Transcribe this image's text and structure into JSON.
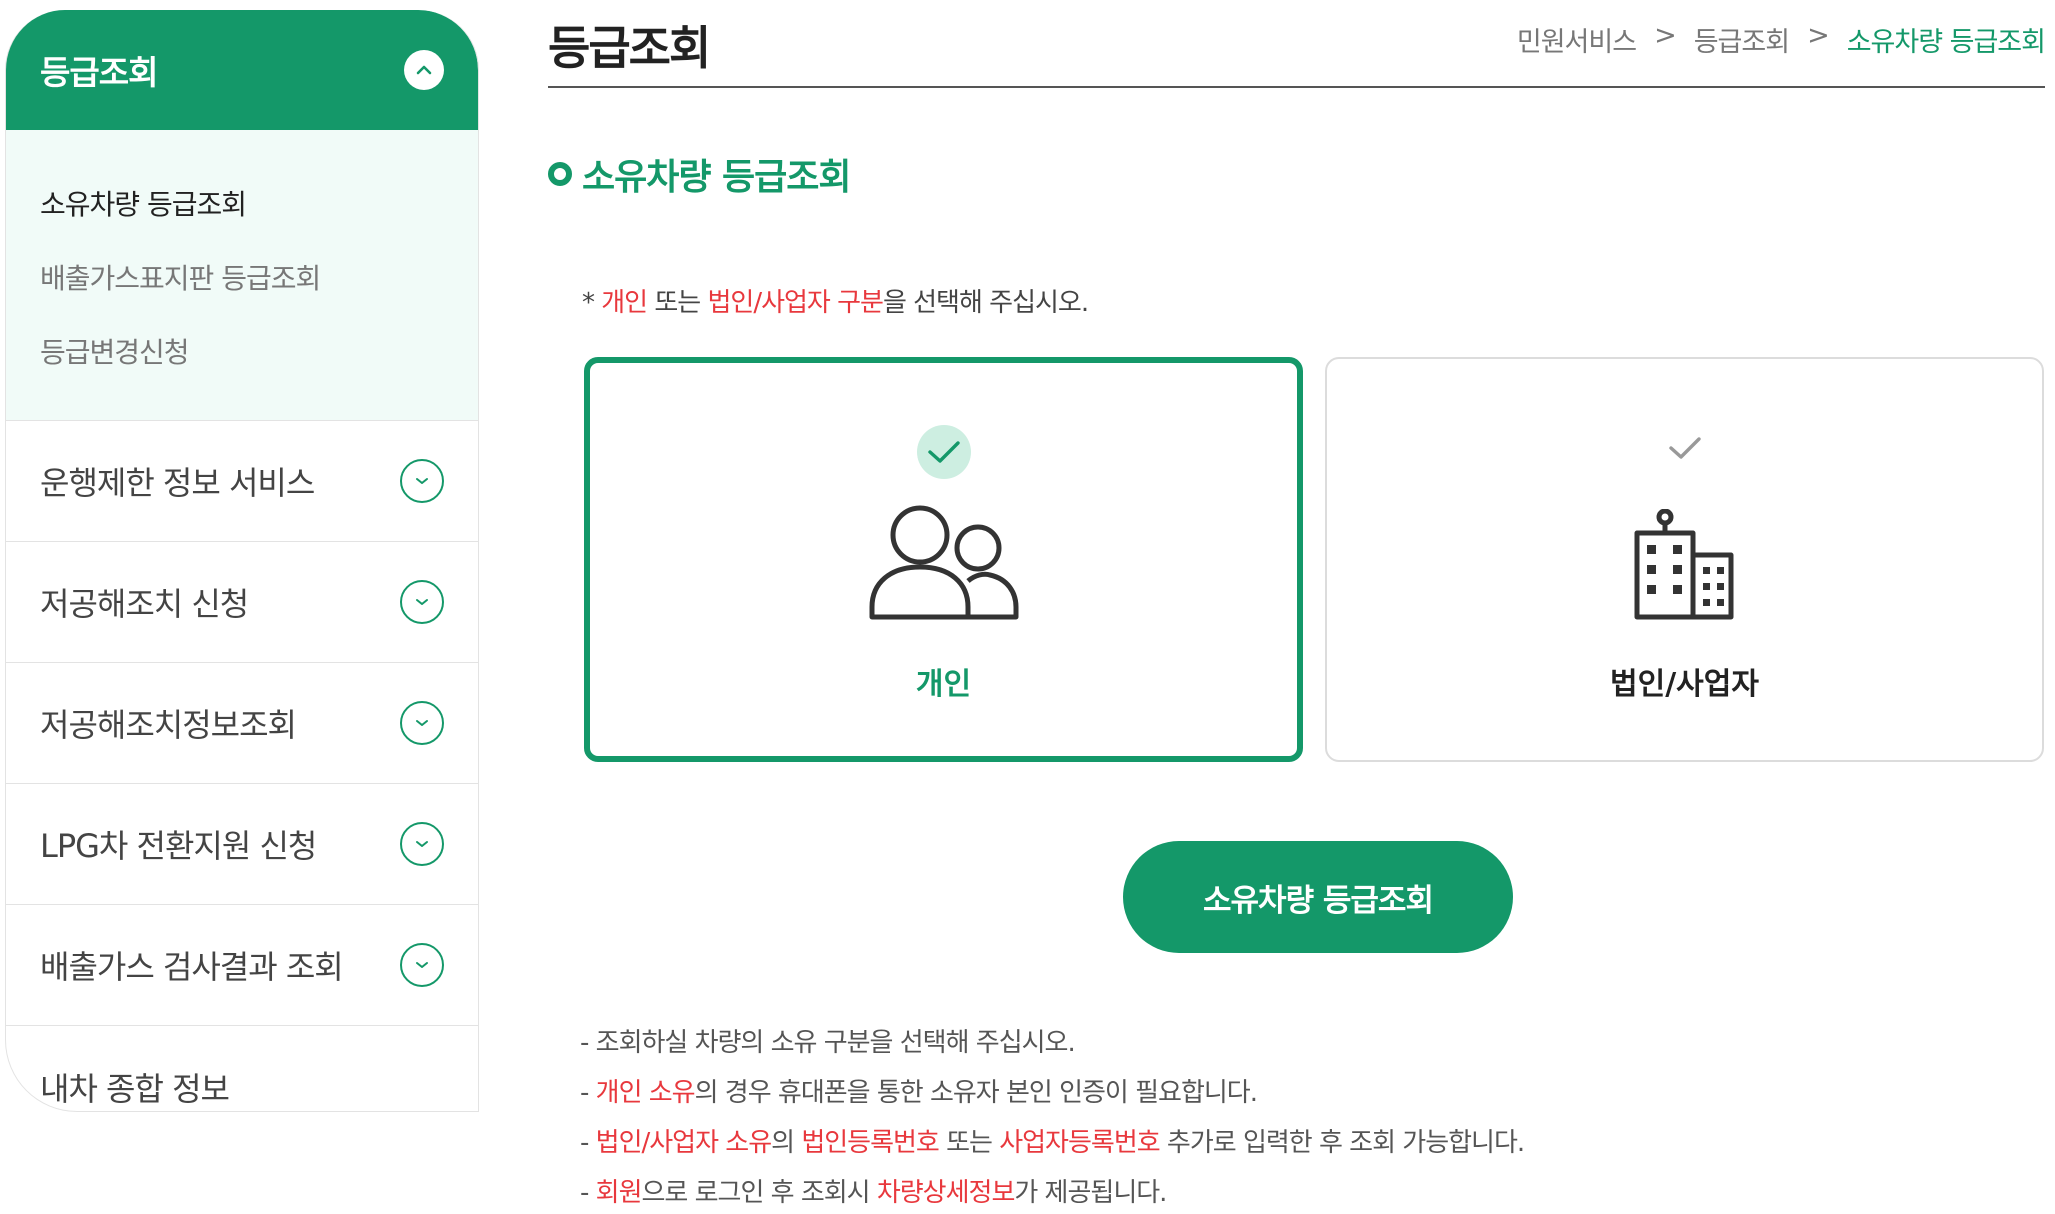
{
  "sidebar": {
    "header": {
      "title": "등급조회"
    },
    "submenu": [
      {
        "label": "소유차량 등급조회"
      },
      {
        "label": "배출가스표지판 등급조회"
      },
      {
        "label": "등급변경신청"
      }
    ],
    "items": [
      {
        "label": "운행제한 정보 서비스"
      },
      {
        "label": "저공해조치 신청"
      },
      {
        "label": "저공해조치정보조회"
      },
      {
        "label": "LPG차 전환지원 신청"
      },
      {
        "label": "배출가스 검사결과 조회"
      },
      {
        "label": "내차 종합 정보"
      }
    ]
  },
  "page": {
    "title": "등급조회",
    "breadcrumb": {
      "first": "민원서비스",
      "sep": ">",
      "second": "등급조회",
      "current": "소유차량 등급조회"
    }
  },
  "section": {
    "title": "소유차량 등급조회"
  },
  "notice": {
    "star": "* ",
    "t1": "개인",
    "t2": " 또는 ",
    "t3": "법인/사업자 구분",
    "t4": "을 선택해 주십시오."
  },
  "options": {
    "individual": {
      "label": "개인",
      "selected": true
    },
    "corporate": {
      "label": "법인/사업자",
      "selected": false
    }
  },
  "submit": {
    "label": "소유차량 등급조회"
  },
  "guide": {
    "line1": {
      "text": "- 조회하실 차량의 소유 구분을 선택해 주십시오."
    },
    "line2": {
      "dash": "- ",
      "r1": "개인 소유",
      "p1": "의 경우 휴대폰을 통한 소유자 본인 인증이 필요합니다."
    },
    "line3": {
      "dash": "- ",
      "r1": "법인/사업자 소유",
      "p1": "의 ",
      "r2": "법인등록번호",
      "p2": " 또는 ",
      "r3": "사업자등록번호",
      "p3": " 추가로 입력한 후 조회 가능합니다."
    },
    "line4": {
      "dash": "- ",
      "r1": "회원",
      "p1": "으로 로그인 후 조회시 ",
      "r2": "차량상세정보",
      "p2": "가 제공됩니다."
    }
  },
  "colors": {
    "accent": "#149869",
    "highlight": "#e8383d",
    "submenu_bg": "#f1fbf8"
  },
  "icons": {
    "collapse": "chevron-up-icon",
    "expand": "chevron-down-icon",
    "person": "people-icon",
    "company": "building-icon",
    "check": "check-icon"
  }
}
